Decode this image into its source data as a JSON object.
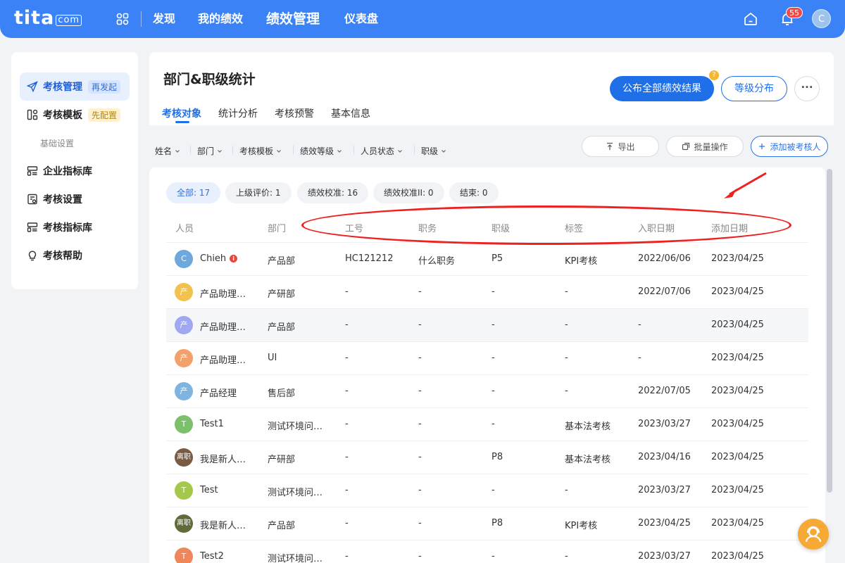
{
  "brand": {
    "logo_main": "tita",
    "logo_suffix": "com",
    "accent": "#3a82f6"
  },
  "topnav": {
    "items": [
      "发现",
      "我的绩效",
      "绩效管理",
      "仪表盘"
    ],
    "notification_count": "55",
    "user_initial": "C"
  },
  "sidebar": {
    "items": [
      {
        "label": "考核管理",
        "tag": "再发起",
        "icon": "send-icon"
      },
      {
        "label": "考核模板",
        "tag": "先配置",
        "icon": "template-icon"
      }
    ],
    "group_label": "基础设置",
    "settings_items": [
      {
        "label": "企业指标库",
        "icon": "list-icon"
      },
      {
        "label": "考核设置",
        "icon": "settings-doc-icon"
      },
      {
        "label": "考核指标库",
        "icon": "list-icon"
      },
      {
        "label": "考核帮助",
        "icon": "lightbulb-icon"
      }
    ]
  },
  "page": {
    "title": "部门&职级统计",
    "tabs": [
      "考核对象",
      "统计分析",
      "考核预警",
      "基本信息"
    ],
    "publish_button": "公布全部绩效结果",
    "help_mark": "?",
    "grade_button": "等级分布",
    "more_button": "···"
  },
  "filters": [
    "姓名",
    "部门",
    "考核模板",
    "绩效等级",
    "人员状态",
    "职级"
  ],
  "toolbar": {
    "export": "导出",
    "batch": "批量操作",
    "add": "添加被考核人"
  },
  "status_pills": [
    "全部: 17",
    "上级评价: 1",
    "绩效校准: 16",
    "绩效校准II: 0",
    "结束: 0"
  ],
  "table": {
    "columns": [
      "人员",
      "部门",
      "工号",
      "职务",
      "职级",
      "标签",
      "入职日期",
      "添加日期"
    ],
    "rows": [
      {
        "avatar": "C",
        "avatar_color": "#6fa8dc",
        "name": "Chieh",
        "info": true,
        "dept": "产品部",
        "emp_id": "HC121212",
        "title": "什么职务",
        "level": "P5",
        "tag": "KPI考核",
        "join": "2022/06/06",
        "added": "2023/04/25"
      },
      {
        "avatar": "产",
        "avatar_color": "#f2c14e",
        "name": "产品助理…",
        "dept": "产研部",
        "emp_id": "-",
        "title": "-",
        "level": "-",
        "tag": "-",
        "join": "2022/07/06",
        "added": "2023/04/25"
      },
      {
        "avatar": "产",
        "avatar_color": "#9fa8f0",
        "name": "产品助理…",
        "dept": "产品部",
        "emp_id": "-",
        "title": "-",
        "level": "-",
        "tag": "-",
        "join": "-",
        "added": "2023/04/25"
      },
      {
        "avatar": "产",
        "avatar_color": "#f4a06b",
        "name": "产品助理…",
        "dept": "UI",
        "emp_id": "-",
        "title": "-",
        "level": "-",
        "tag": "-",
        "join": "-",
        "added": "2023/04/25"
      },
      {
        "avatar": "产",
        "avatar_color": "#7fb3e0",
        "name": "产品经理",
        "dept": "售后部",
        "emp_id": "-",
        "title": "-",
        "level": "-",
        "tag": "-",
        "join": "2022/07/05",
        "added": "2023/04/25"
      },
      {
        "avatar": "T",
        "avatar_color": "#7cc06b",
        "name": "Test1",
        "dept": "测试环境问…",
        "emp_id": "-",
        "title": "-",
        "level": "-",
        "tag": "基本法考核",
        "join": "2023/03/27",
        "added": "2023/04/25"
      },
      {
        "avatar": "离职",
        "avatar_color": "#7a5a43",
        "name": "我是新人…",
        "dept": "产研部",
        "emp_id": "-",
        "title": "-",
        "level": "P8",
        "tag": "基本法考核",
        "join": "2023/04/16",
        "added": "2023/04/25"
      },
      {
        "avatar": "T",
        "avatar_color": "#a6c84a",
        "name": "Test",
        "dept": "测试环境问…",
        "emp_id": "-",
        "title": "-",
        "level": "-",
        "tag": "-",
        "join": "2023/03/27",
        "added": "2023/04/25"
      },
      {
        "avatar": "离职",
        "avatar_color": "#5f6b3a",
        "name": "我是新人…",
        "dept": "产品部",
        "emp_id": "-",
        "title": "-",
        "level": "P8",
        "tag": "KPI考核",
        "join": "2023/04/25",
        "added": "2023/04/25"
      },
      {
        "avatar": "T",
        "avatar_color": "#f0875a",
        "name": "Test2",
        "dept": "测试环境问…",
        "emp_id": "-",
        "title": "-",
        "level": "-",
        "tag": "-",
        "join": "2023/03/27",
        "added": "2023/04/25"
      }
    ]
  },
  "annotation": {
    "color": "#ee2020"
  }
}
